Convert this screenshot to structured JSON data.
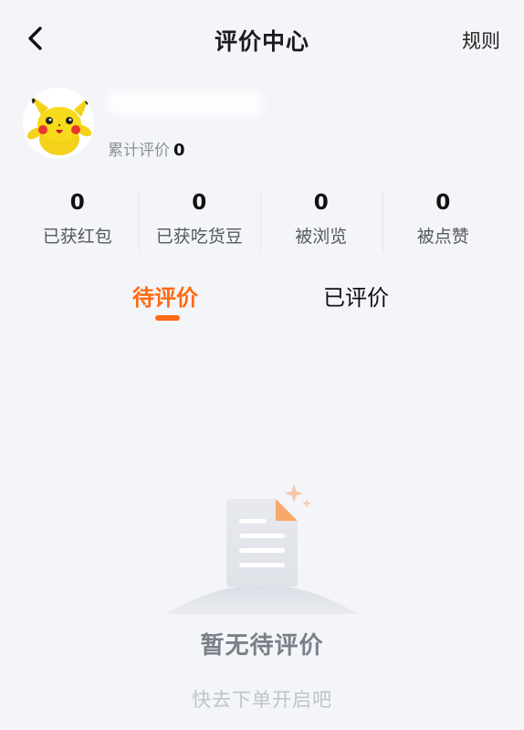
{
  "header": {
    "title": "评价中心",
    "rules_label": "规则"
  },
  "profile": {
    "review_total_label": "累计评价",
    "review_total_value": "0"
  },
  "stats": [
    {
      "value": "0",
      "label": "已获红包"
    },
    {
      "value": "0",
      "label": "已获吃货豆"
    },
    {
      "value": "0",
      "label": "被浏览"
    },
    {
      "value": "0",
      "label": "被点赞"
    }
  ],
  "tabs": [
    {
      "label": "待评价",
      "active": true
    },
    {
      "label": "已评价",
      "active": false
    }
  ],
  "empty_state": {
    "title": "暂无待评价",
    "subtitle": "快去下单开启吧"
  },
  "colors": {
    "accent": "#ff6a12",
    "background": "#f3f5f9"
  },
  "icons": {
    "back": "chevron-left-icon",
    "empty": "empty-document-icon"
  }
}
